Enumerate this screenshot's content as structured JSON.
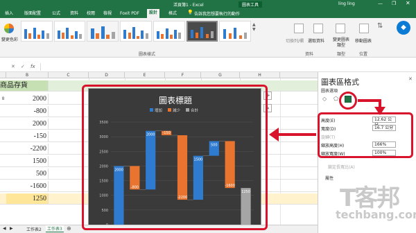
{
  "window": {
    "title": "活頁簿1 - Excel",
    "context_tab": "圖表工具",
    "user": "ling ling",
    "tell_me": "告訴我您想要執行的動作"
  },
  "ribbon_tabs": [
    "插入",
    "版面配置",
    "公式",
    "資料",
    "校閱",
    "檢視",
    "Foxit PDF",
    "設計",
    "格式"
  ],
  "active_tab": "設計",
  "ribbon": {
    "left_buttons": [
      "變更色彩"
    ],
    "right_buttons": [
      "切換列/欄",
      "選取資料",
      "變更圖表類型",
      "移動圖表"
    ],
    "group_labels": [
      "圖表樣式",
      "資料",
      "類型",
      "位置"
    ]
  },
  "formula_bar": {
    "fx": "fx"
  },
  "columns": [
    "B",
    "C",
    "D",
    "E",
    "F",
    "G",
    "H"
  ],
  "column_b_header": "商品存貨",
  "rows": [
    {
      "a": "8",
      "b": "2000"
    },
    {
      "a": "",
      "b": "-800"
    },
    {
      "a": "",
      "b": "2000"
    },
    {
      "a": "",
      "b": "-150"
    },
    {
      "a": "",
      "b": "-2200"
    },
    {
      "a": "",
      "b": "1500"
    },
    {
      "a": "",
      "b": "500"
    },
    {
      "a": "",
      "b": "-1600"
    },
    {
      "a": "",
      "b": "1250"
    }
  ],
  "sheet_tabs": [
    "工作表2",
    "工作表3"
  ],
  "chart": {
    "title": "圖表標題"
  },
  "chart_data": {
    "type": "bar",
    "subtype": "waterfall",
    "title": "圖表標題",
    "legend": [
      "增加",
      "減少",
      "合計"
    ],
    "legend_position": "top",
    "ylim": [
      0,
      3500
    ],
    "yticks": [
      "3500",
      "3000",
      "2500",
      "2000",
      "1500",
      "1000",
      "500",
      "0"
    ],
    "bars": [
      {
        "label": "2000",
        "start": 0,
        "end": 2000,
        "kind": "increase"
      },
      {
        "label": "-800",
        "start": 2000,
        "end": 1200,
        "kind": "decrease"
      },
      {
        "label": "2000",
        "start": 1200,
        "end": 3200,
        "kind": "increase"
      },
      {
        "label": "-150",
        "start": 3200,
        "end": 3050,
        "kind": "decrease"
      },
      {
        "label": "-2200",
        "start": 3050,
        "end": 850,
        "kind": "decrease"
      },
      {
        "label": "1500",
        "start": 850,
        "end": 2350,
        "kind": "increase"
      },
      {
        "label": "500",
        "start": 2350,
        "end": 2850,
        "kind": "increase"
      },
      {
        "label": "-1600",
        "start": 2850,
        "end": 1250,
        "kind": "decrease"
      },
      {
        "label": "1250",
        "start": 0,
        "end": 1250,
        "kind": "total"
      }
    ],
    "colors": {
      "increase": "#2e7bcf",
      "decrease": "#e8742f",
      "total": "#a5a5a5"
    }
  },
  "pane": {
    "title": "圖表區格式",
    "options_label": "圖表選項",
    "fields": [
      {
        "label": "高度(E)",
        "value": "12.62 公分"
      },
      {
        "label": "寬度(D)",
        "value": "16.7 公分"
      },
      {
        "label": "旋轉(T)",
        "value": ""
      },
      {
        "label": "縮放高度(H)",
        "value": "166%"
      },
      {
        "label": "縮放寬度(W)",
        "value": "100%"
      }
    ],
    "checkbox_label": "鎖定長寬比(A)",
    "section_label": "屬性"
  },
  "watermark": {
    "text": "T客邦",
    "url": "techbang.com"
  }
}
